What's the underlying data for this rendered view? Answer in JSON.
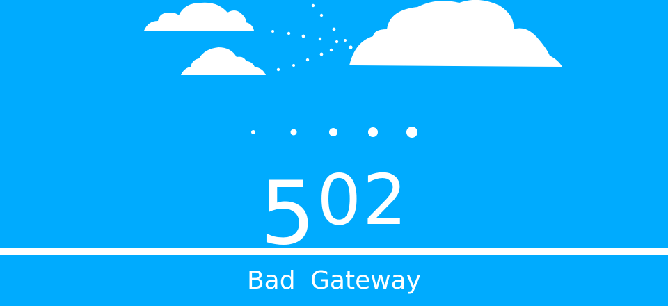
{
  "error": {
    "code_first": "5",
    "code_rest": "02",
    "message": "Bad Gateway"
  },
  "theme": {
    "background": "#00abfe",
    "foreground": "#ffffff"
  },
  "icons": {
    "clouds": [
      "cloud-icon",
      "cloud-icon",
      "cloud-icon"
    ],
    "loader": "loading-dots-icon"
  }
}
